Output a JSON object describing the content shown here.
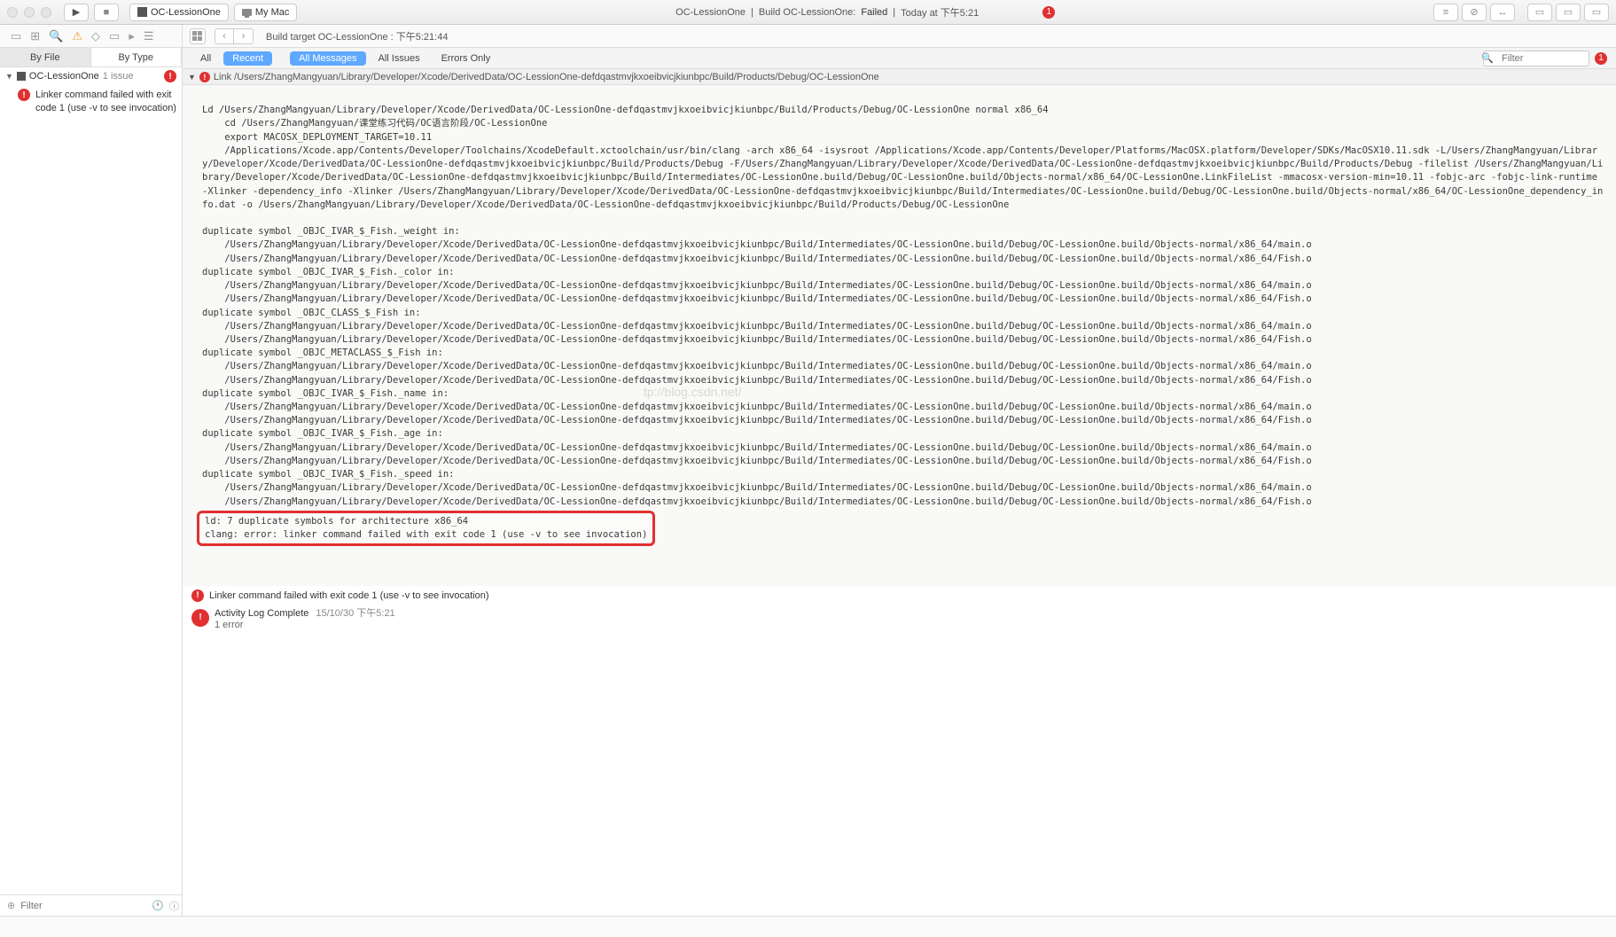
{
  "titlebar": {
    "scheme": "OC-LessionOne",
    "device": "My Mac",
    "status_project": "OC-LessionOne",
    "status_build": "Build OC-LessionOne:",
    "status_result": "Failed",
    "status_time": "Today at 下午5:21",
    "error_count": "1"
  },
  "breadcrumb": "Build target OC-LessionOne : 下午5:21:44",
  "sidebar": {
    "tab_byfile": "By File",
    "tab_bytype": "By Type",
    "project": "OC-LessionOne",
    "issue_count": "1 issue",
    "error_text": "Linker command failed with exit code 1 (use -v to see invocation)",
    "filter_placeholder": "Filter"
  },
  "filters": {
    "all": "All",
    "recent": "Recent",
    "allmsg": "All Messages",
    "allissues": "All Issues",
    "erroronly": "Errors Only",
    "filter_placeholder": "Filter"
  },
  "link_header": "Link /Users/ZhangMangyuan/Library/Developer/Xcode/DerivedData/OC-LessionOne-defdqastmvjkxoeibvicjkiunbpc/Build/Products/Debug/OC-LessionOne",
  "log_text": "Ld /Users/ZhangMangyuan/Library/Developer/Xcode/DerivedData/OC-LessionOne-defdqastmvjkxoeibvicjkiunbpc/Build/Products/Debug/OC-LessionOne normal x86_64\n    cd /Users/ZhangMangyuan/课堂练习代码/OC语言阶段/OC-LessionOne\n    export MACOSX_DEPLOYMENT_TARGET=10.11\n    /Applications/Xcode.app/Contents/Developer/Toolchains/XcodeDefault.xctoolchain/usr/bin/clang -arch x86_64 -isysroot /Applications/Xcode.app/Contents/Developer/Platforms/MacOSX.platform/Developer/SDKs/MacOSX10.11.sdk -L/Users/ZhangMangyuan/Library/Developer/Xcode/DerivedData/OC-LessionOne-defdqastmvjkxoeibvicjkiunbpc/Build/Products/Debug -F/Users/ZhangMangyuan/Library/Developer/Xcode/DerivedData/OC-LessionOne-defdqastmvjkxoeibvicjkiunbpc/Build/Products/Debug -filelist /Users/ZhangMangyuan/Library/Developer/Xcode/DerivedData/OC-LessionOne-defdqastmvjkxoeibvicjkiunbpc/Build/Intermediates/OC-LessionOne.build/Debug/OC-LessionOne.build/Objects-normal/x86_64/OC-LessionOne.LinkFileList -mmacosx-version-min=10.11 -fobjc-arc -fobjc-link-runtime -Xlinker -dependency_info -Xlinker /Users/ZhangMangyuan/Library/Developer/Xcode/DerivedData/OC-LessionOne-defdqastmvjkxoeibvicjkiunbpc/Build/Intermediates/OC-LessionOne.build/Debug/OC-LessionOne.build/Objects-normal/x86_64/OC-LessionOne_dependency_info.dat -o /Users/ZhangMangyuan/Library/Developer/Xcode/DerivedData/OC-LessionOne-defdqastmvjkxoeibvicjkiunbpc/Build/Products/Debug/OC-LessionOne\n\nduplicate symbol _OBJC_IVAR_$_Fish._weight in:\n    /Users/ZhangMangyuan/Library/Developer/Xcode/DerivedData/OC-LessionOne-defdqastmvjkxoeibvicjkiunbpc/Build/Intermediates/OC-LessionOne.build/Debug/OC-LessionOne.build/Objects-normal/x86_64/main.o\n    /Users/ZhangMangyuan/Library/Developer/Xcode/DerivedData/OC-LessionOne-defdqastmvjkxoeibvicjkiunbpc/Build/Intermediates/OC-LessionOne.build/Debug/OC-LessionOne.build/Objects-normal/x86_64/Fish.o\nduplicate symbol _OBJC_IVAR_$_Fish._color in:\n    /Users/ZhangMangyuan/Library/Developer/Xcode/DerivedData/OC-LessionOne-defdqastmvjkxoeibvicjkiunbpc/Build/Intermediates/OC-LessionOne.build/Debug/OC-LessionOne.build/Objects-normal/x86_64/main.o\n    /Users/ZhangMangyuan/Library/Developer/Xcode/DerivedData/OC-LessionOne-defdqastmvjkxoeibvicjkiunbpc/Build/Intermediates/OC-LessionOne.build/Debug/OC-LessionOne.build/Objects-normal/x86_64/Fish.o\nduplicate symbol _OBJC_CLASS_$_Fish in:\n    /Users/ZhangMangyuan/Library/Developer/Xcode/DerivedData/OC-LessionOne-defdqastmvjkxoeibvicjkiunbpc/Build/Intermediates/OC-LessionOne.build/Debug/OC-LessionOne.build/Objects-normal/x86_64/main.o\n    /Users/ZhangMangyuan/Library/Developer/Xcode/DerivedData/OC-LessionOne-defdqastmvjkxoeibvicjkiunbpc/Build/Intermediates/OC-LessionOne.build/Debug/OC-LessionOne.build/Objects-normal/x86_64/Fish.o\nduplicate symbol _OBJC_METACLASS_$_Fish in:\n    /Users/ZhangMangyuan/Library/Developer/Xcode/DerivedData/OC-LessionOne-defdqastmvjkxoeibvicjkiunbpc/Build/Intermediates/OC-LessionOne.build/Debug/OC-LessionOne.build/Objects-normal/x86_64/main.o\n    /Users/ZhangMangyuan/Library/Developer/Xcode/DerivedData/OC-LessionOne-defdqastmvjkxoeibvicjkiunbpc/Build/Intermediates/OC-LessionOne.build/Debug/OC-LessionOne.build/Objects-normal/x86_64/Fish.o\nduplicate symbol _OBJC_IVAR_$_Fish._name in:\n    /Users/ZhangMangyuan/Library/Developer/Xcode/DerivedData/OC-LessionOne-defdqastmvjkxoeibvicjkiunbpc/Build/Intermediates/OC-LessionOne.build/Debug/OC-LessionOne.build/Objects-normal/x86_64/main.o\n    /Users/ZhangMangyuan/Library/Developer/Xcode/DerivedData/OC-LessionOne-defdqastmvjkxoeibvicjkiunbpc/Build/Intermediates/OC-LessionOne.build/Debug/OC-LessionOne.build/Objects-normal/x86_64/Fish.o\nduplicate symbol _OBJC_IVAR_$_Fish._age in:\n    /Users/ZhangMangyuan/Library/Developer/Xcode/DerivedData/OC-LessionOne-defdqastmvjkxoeibvicjkiunbpc/Build/Intermediates/OC-LessionOne.build/Debug/OC-LessionOne.build/Objects-normal/x86_64/main.o\n    /Users/ZhangMangyuan/Library/Developer/Xcode/DerivedData/OC-LessionOne-defdqastmvjkxoeibvicjkiunbpc/Build/Intermediates/OC-LessionOne.build/Debug/OC-LessionOne.build/Objects-normal/x86_64/Fish.o\nduplicate symbol _OBJC_IVAR_$_Fish._speed in:\n    /Users/ZhangMangyuan/Library/Developer/Xcode/DerivedData/OC-LessionOne-defdqastmvjkxoeibvicjkiunbpc/Build/Intermediates/OC-LessionOne.build/Debug/OC-LessionOne.build/Objects-normal/x86_64/main.o\n    /Users/ZhangMangyuan/Library/Developer/Xcode/DerivedData/OC-LessionOne-defdqastmvjkxoeibvicjkiunbpc/Build/Intermediates/OC-LessionOne.build/Debug/OC-LessionOne.build/Objects-normal/x86_64/Fish.o",
  "highlight_text": "ld: 7 duplicate symbols for architecture x86_64\nclang: error: linker command failed with exit code 1 (use -v to see invocation)",
  "issues": {
    "dup_title": "Duplicate symbols for architecture x86_64",
    "link_fail": "Linker command failed with exit code 1 (use -v to see invocation)",
    "activity": "Activity Log Complete",
    "activity_ts": "15/10/30 下午5:21",
    "activity_sub": "1 error"
  },
  "watermark": "tp://blog.csdn.net/"
}
